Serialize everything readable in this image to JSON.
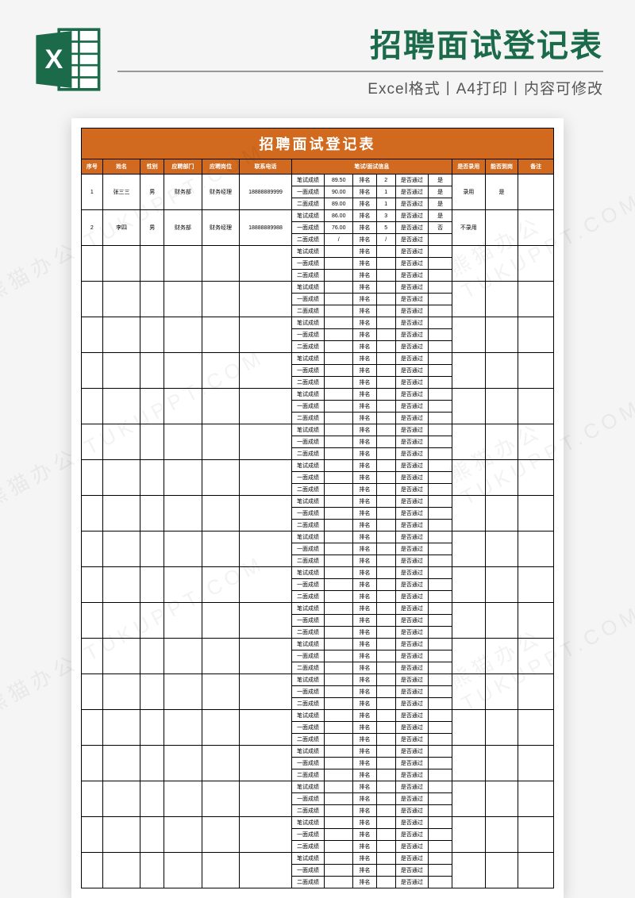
{
  "header": {
    "main_title": "招聘面试登记表",
    "sub_title": "Excel格式丨A4打印丨内容可修改",
    "icon_name": "excel-icon"
  },
  "sheet": {
    "title": "招聘面试登记表",
    "columns": {
      "seq": "序号",
      "name": "姓名",
      "sex": "性别",
      "dept": "应聘部门",
      "pos": "应聘岗位",
      "tel": "联系电话",
      "exam": "笔试/面试信息",
      "hire": "是否录用",
      "arrive": "能否到岗",
      "note": "备注"
    },
    "subLabels": {
      "written": "笔试成绩",
      "first": "一面成绩",
      "second": "二面成绩",
      "rank": "排名",
      "pass": "是否通过"
    },
    "rows": [
      {
        "seq": "1",
        "name": "张三三",
        "sex": "男",
        "dept": "财务部",
        "pos": "财务经理",
        "tel": "18888889999",
        "written": {
          "score": "89.50",
          "rank": "2",
          "pass": "是"
        },
        "first": {
          "score": "90.00",
          "rank": "1",
          "pass": "是"
        },
        "second": {
          "score": "89.00",
          "rank": "1",
          "pass": "是"
        },
        "hire": "录用",
        "arrive": "是",
        "note": ""
      },
      {
        "seq": "2",
        "name": "李四",
        "sex": "男",
        "dept": "财务部",
        "pos": "财务经理",
        "tel": "18888889988",
        "written": {
          "score": "86.00",
          "rank": "3",
          "pass": "是"
        },
        "first": {
          "score": "76.00",
          "rank": "5",
          "pass": "否"
        },
        "second": {
          "score": "/",
          "rank": "/",
          "pass": ""
        },
        "hire": "不录用",
        "arrive": "",
        "note": ""
      },
      {
        "seq": "",
        "name": "",
        "sex": "",
        "dept": "",
        "pos": "",
        "tel": "",
        "written": {
          "score": "",
          "rank": "",
          "pass": ""
        },
        "first": {
          "score": "",
          "rank": "",
          "pass": ""
        },
        "second": {
          "score": "",
          "rank": "",
          "pass": ""
        },
        "hire": "",
        "arrive": "",
        "note": ""
      },
      {
        "seq": "",
        "name": "",
        "sex": "",
        "dept": "",
        "pos": "",
        "tel": "",
        "written": {
          "score": "",
          "rank": "",
          "pass": ""
        },
        "first": {
          "score": "",
          "rank": "",
          "pass": ""
        },
        "second": {
          "score": "",
          "rank": "",
          "pass": ""
        },
        "hire": "",
        "arrive": "",
        "note": ""
      },
      {
        "seq": "",
        "name": "",
        "sex": "",
        "dept": "",
        "pos": "",
        "tel": "",
        "written": {
          "score": "",
          "rank": "",
          "pass": ""
        },
        "first": {
          "score": "",
          "rank": "",
          "pass": ""
        },
        "second": {
          "score": "",
          "rank": "",
          "pass": ""
        },
        "hire": "",
        "arrive": "",
        "note": ""
      },
      {
        "seq": "",
        "name": "",
        "sex": "",
        "dept": "",
        "pos": "",
        "tel": "",
        "written": {
          "score": "",
          "rank": "",
          "pass": ""
        },
        "first": {
          "score": "",
          "rank": "",
          "pass": ""
        },
        "second": {
          "score": "",
          "rank": "",
          "pass": ""
        },
        "hire": "",
        "arrive": "",
        "note": ""
      },
      {
        "seq": "",
        "name": "",
        "sex": "",
        "dept": "",
        "pos": "",
        "tel": "",
        "written": {
          "score": "",
          "rank": "",
          "pass": ""
        },
        "first": {
          "score": "",
          "rank": "",
          "pass": ""
        },
        "second": {
          "score": "",
          "rank": "",
          "pass": ""
        },
        "hire": "",
        "arrive": "",
        "note": ""
      },
      {
        "seq": "",
        "name": "",
        "sex": "",
        "dept": "",
        "pos": "",
        "tel": "",
        "written": {
          "score": "",
          "rank": "",
          "pass": ""
        },
        "first": {
          "score": "",
          "rank": "",
          "pass": ""
        },
        "second": {
          "score": "",
          "rank": "",
          "pass": ""
        },
        "hire": "",
        "arrive": "",
        "note": ""
      },
      {
        "seq": "",
        "name": "",
        "sex": "",
        "dept": "",
        "pos": "",
        "tel": "",
        "written": {
          "score": "",
          "rank": "",
          "pass": ""
        },
        "first": {
          "score": "",
          "rank": "",
          "pass": ""
        },
        "second": {
          "score": "",
          "rank": "",
          "pass": ""
        },
        "hire": "",
        "arrive": "",
        "note": ""
      },
      {
        "seq": "",
        "name": "",
        "sex": "",
        "dept": "",
        "pos": "",
        "tel": "",
        "written": {
          "score": "",
          "rank": "",
          "pass": ""
        },
        "first": {
          "score": "",
          "rank": "",
          "pass": ""
        },
        "second": {
          "score": "",
          "rank": "",
          "pass": ""
        },
        "hire": "",
        "arrive": "",
        "note": ""
      },
      {
        "seq": "",
        "name": "",
        "sex": "",
        "dept": "",
        "pos": "",
        "tel": "",
        "written": {
          "score": "",
          "rank": "",
          "pass": ""
        },
        "first": {
          "score": "",
          "rank": "",
          "pass": ""
        },
        "second": {
          "score": "",
          "rank": "",
          "pass": ""
        },
        "hire": "",
        "arrive": "",
        "note": ""
      },
      {
        "seq": "",
        "name": "",
        "sex": "",
        "dept": "",
        "pos": "",
        "tel": "",
        "written": {
          "score": "",
          "rank": "",
          "pass": ""
        },
        "first": {
          "score": "",
          "rank": "",
          "pass": ""
        },
        "second": {
          "score": "",
          "rank": "",
          "pass": ""
        },
        "hire": "",
        "arrive": "",
        "note": ""
      },
      {
        "seq": "",
        "name": "",
        "sex": "",
        "dept": "",
        "pos": "",
        "tel": "",
        "written": {
          "score": "",
          "rank": "",
          "pass": ""
        },
        "first": {
          "score": "",
          "rank": "",
          "pass": ""
        },
        "second": {
          "score": "",
          "rank": "",
          "pass": ""
        },
        "hire": "",
        "arrive": "",
        "note": ""
      },
      {
        "seq": "",
        "name": "",
        "sex": "",
        "dept": "",
        "pos": "",
        "tel": "",
        "written": {
          "score": "",
          "rank": "",
          "pass": ""
        },
        "first": {
          "score": "",
          "rank": "",
          "pass": ""
        },
        "second": {
          "score": "",
          "rank": "",
          "pass": ""
        },
        "hire": "",
        "arrive": "",
        "note": ""
      },
      {
        "seq": "",
        "name": "",
        "sex": "",
        "dept": "",
        "pos": "",
        "tel": "",
        "written": {
          "score": "",
          "rank": "",
          "pass": ""
        },
        "first": {
          "score": "",
          "rank": "",
          "pass": ""
        },
        "second": {
          "score": "",
          "rank": "",
          "pass": ""
        },
        "hire": "",
        "arrive": "",
        "note": ""
      },
      {
        "seq": "",
        "name": "",
        "sex": "",
        "dept": "",
        "pos": "",
        "tel": "",
        "written": {
          "score": "",
          "rank": "",
          "pass": ""
        },
        "first": {
          "score": "",
          "rank": "",
          "pass": ""
        },
        "second": {
          "score": "",
          "rank": "",
          "pass": ""
        },
        "hire": "",
        "arrive": "",
        "note": ""
      },
      {
        "seq": "",
        "name": "",
        "sex": "",
        "dept": "",
        "pos": "",
        "tel": "",
        "written": {
          "score": "",
          "rank": "",
          "pass": ""
        },
        "first": {
          "score": "",
          "rank": "",
          "pass": ""
        },
        "second": {
          "score": "",
          "rank": "",
          "pass": ""
        },
        "hire": "",
        "arrive": "",
        "note": ""
      },
      {
        "seq": "",
        "name": "",
        "sex": "",
        "dept": "",
        "pos": "",
        "tel": "",
        "written": {
          "score": "",
          "rank": "",
          "pass": ""
        },
        "first": {
          "score": "",
          "rank": "",
          "pass": ""
        },
        "second": {
          "score": "",
          "rank": "",
          "pass": ""
        },
        "hire": "",
        "arrive": "",
        "note": ""
      },
      {
        "seq": "",
        "name": "",
        "sex": "",
        "dept": "",
        "pos": "",
        "tel": "",
        "written": {
          "score": "",
          "rank": "",
          "pass": ""
        },
        "first": {
          "score": "",
          "rank": "",
          "pass": ""
        },
        "second": {
          "score": "",
          "rank": "",
          "pass": ""
        },
        "hire": "",
        "arrive": "",
        "note": ""
      },
      {
        "seq": "",
        "name": "",
        "sex": "",
        "dept": "",
        "pos": "",
        "tel": "",
        "written": {
          "score": "",
          "rank": "",
          "pass": ""
        },
        "first": {
          "score": "",
          "rank": "",
          "pass": ""
        },
        "second": {
          "score": "",
          "rank": "",
          "pass": ""
        },
        "hire": "",
        "arrive": "",
        "note": ""
      }
    ]
  },
  "watermark": "熊猫办公 TUKUPPT.COM"
}
